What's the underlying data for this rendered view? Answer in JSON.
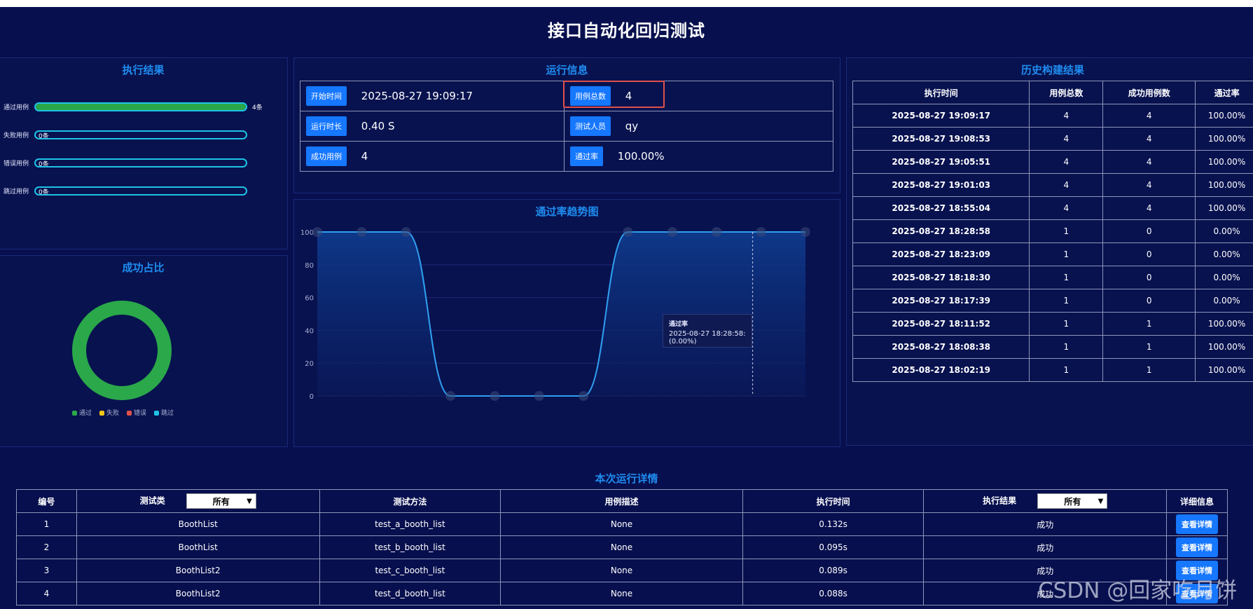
{
  "page_title": "接口自动化回归测试",
  "exec_result": {
    "title": "执行结果",
    "bars": [
      {
        "label": "通过用例",
        "fraction": 1.0,
        "inner": "",
        "count": "4条",
        "color": "#2aa84a"
      },
      {
        "label": "失败用例",
        "fraction": 0.0,
        "inner": "0条",
        "count": "",
        "color": "#2aa84a"
      },
      {
        "label": "错误用例",
        "fraction": 0.0,
        "inner": "0条",
        "count": "",
        "color": "#2aa84a"
      },
      {
        "label": "跳过用例",
        "fraction": 0.0,
        "inner": "0条",
        "count": "",
        "color": "#2aa84a"
      }
    ]
  },
  "success_ratio": {
    "title": "成功占比",
    "legend": [
      {
        "label": "通过",
        "color": "#2aa84a"
      },
      {
        "label": "失败",
        "color": "#f5c518"
      },
      {
        "label": "错误",
        "color": "#e0504a"
      },
      {
        "label": "跳过",
        "color": "#1ec3e6"
      }
    ],
    "pass_fraction": 1.0
  },
  "run_info": {
    "title": "运行信息",
    "start_label": "开始时间",
    "start_value": "2025-08-27 19:09:17",
    "total_label": "用例总数",
    "total_value": "4",
    "duration_label": "运行时长",
    "duration_value": "0.40 S",
    "tester_label": "测试人员",
    "tester_value": "qy",
    "success_label": "成功用例",
    "success_value": "4",
    "rate_label": "通过率",
    "rate_value": "100.00%"
  },
  "trend": {
    "title": "通过率趋势图",
    "tooltip_title": "通过率",
    "tooltip_value": "2025-08-27 18:28:58: (0.00%)"
  },
  "chart_data": {
    "type": "area",
    "title": "通过率趋势图",
    "y_ticks": [
      "100",
      "80",
      "60",
      "40",
      "20",
      "0"
    ],
    "ylim": [
      0,
      100
    ],
    "series": [
      {
        "values": [
          100,
          100,
          100,
          0,
          0,
          0,
          0,
          100,
          100,
          100,
          100,
          100
        ]
      }
    ],
    "grid": true
  },
  "history": {
    "title": "历史构建结果",
    "headers": [
      "执行时间",
      "用例总数",
      "成功用例数",
      "通过率"
    ],
    "rows": [
      [
        "2025-08-27 19:09:17",
        "4",
        "4",
        "100.00%"
      ],
      [
        "2025-08-27 19:08:53",
        "4",
        "4",
        "100.00%"
      ],
      [
        "2025-08-27 19:05:51",
        "4",
        "4",
        "100.00%"
      ],
      [
        "2025-08-27 19:01:03",
        "4",
        "4",
        "100.00%"
      ],
      [
        "2025-08-27 18:55:04",
        "4",
        "4",
        "100.00%"
      ],
      [
        "2025-08-27 18:28:58",
        "1",
        "0",
        "0.00%"
      ],
      [
        "2025-08-27 18:23:09",
        "1",
        "0",
        "0.00%"
      ],
      [
        "2025-08-27 18:18:30",
        "1",
        "0",
        "0.00%"
      ],
      [
        "2025-08-27 18:17:39",
        "1",
        "0",
        "0.00%"
      ],
      [
        "2025-08-27 18:11:52",
        "1",
        "1",
        "100.00%"
      ],
      [
        "2025-08-27 18:08:38",
        "1",
        "1",
        "100.00%"
      ],
      [
        "2025-08-27 18:02:19",
        "1",
        "1",
        "100.00%"
      ]
    ]
  },
  "details": {
    "title": "本次运行详情",
    "headers": [
      "编号",
      "测试类",
      "测试方法",
      "用例描述",
      "执行时间",
      "执行结果",
      "详细信息"
    ],
    "class_filter": "所有",
    "result_filter": "所有",
    "rows": [
      [
        "1",
        "BoothList",
        "test_a_booth_list",
        "None",
        "0.132s",
        "成功",
        "查看详情"
      ],
      [
        "2",
        "BoothList",
        "test_b_booth_list",
        "None",
        "0.095s",
        "成功",
        "查看详情"
      ],
      [
        "3",
        "BoothList2",
        "test_c_booth_list",
        "None",
        "0.089s",
        "成功",
        "查看详情"
      ],
      [
        "4",
        "BoothList2",
        "test_d_booth_list",
        "None",
        "0.088s",
        "成功",
        "查看详情"
      ]
    ]
  },
  "watermark": "CSDN @回家吃月饼"
}
